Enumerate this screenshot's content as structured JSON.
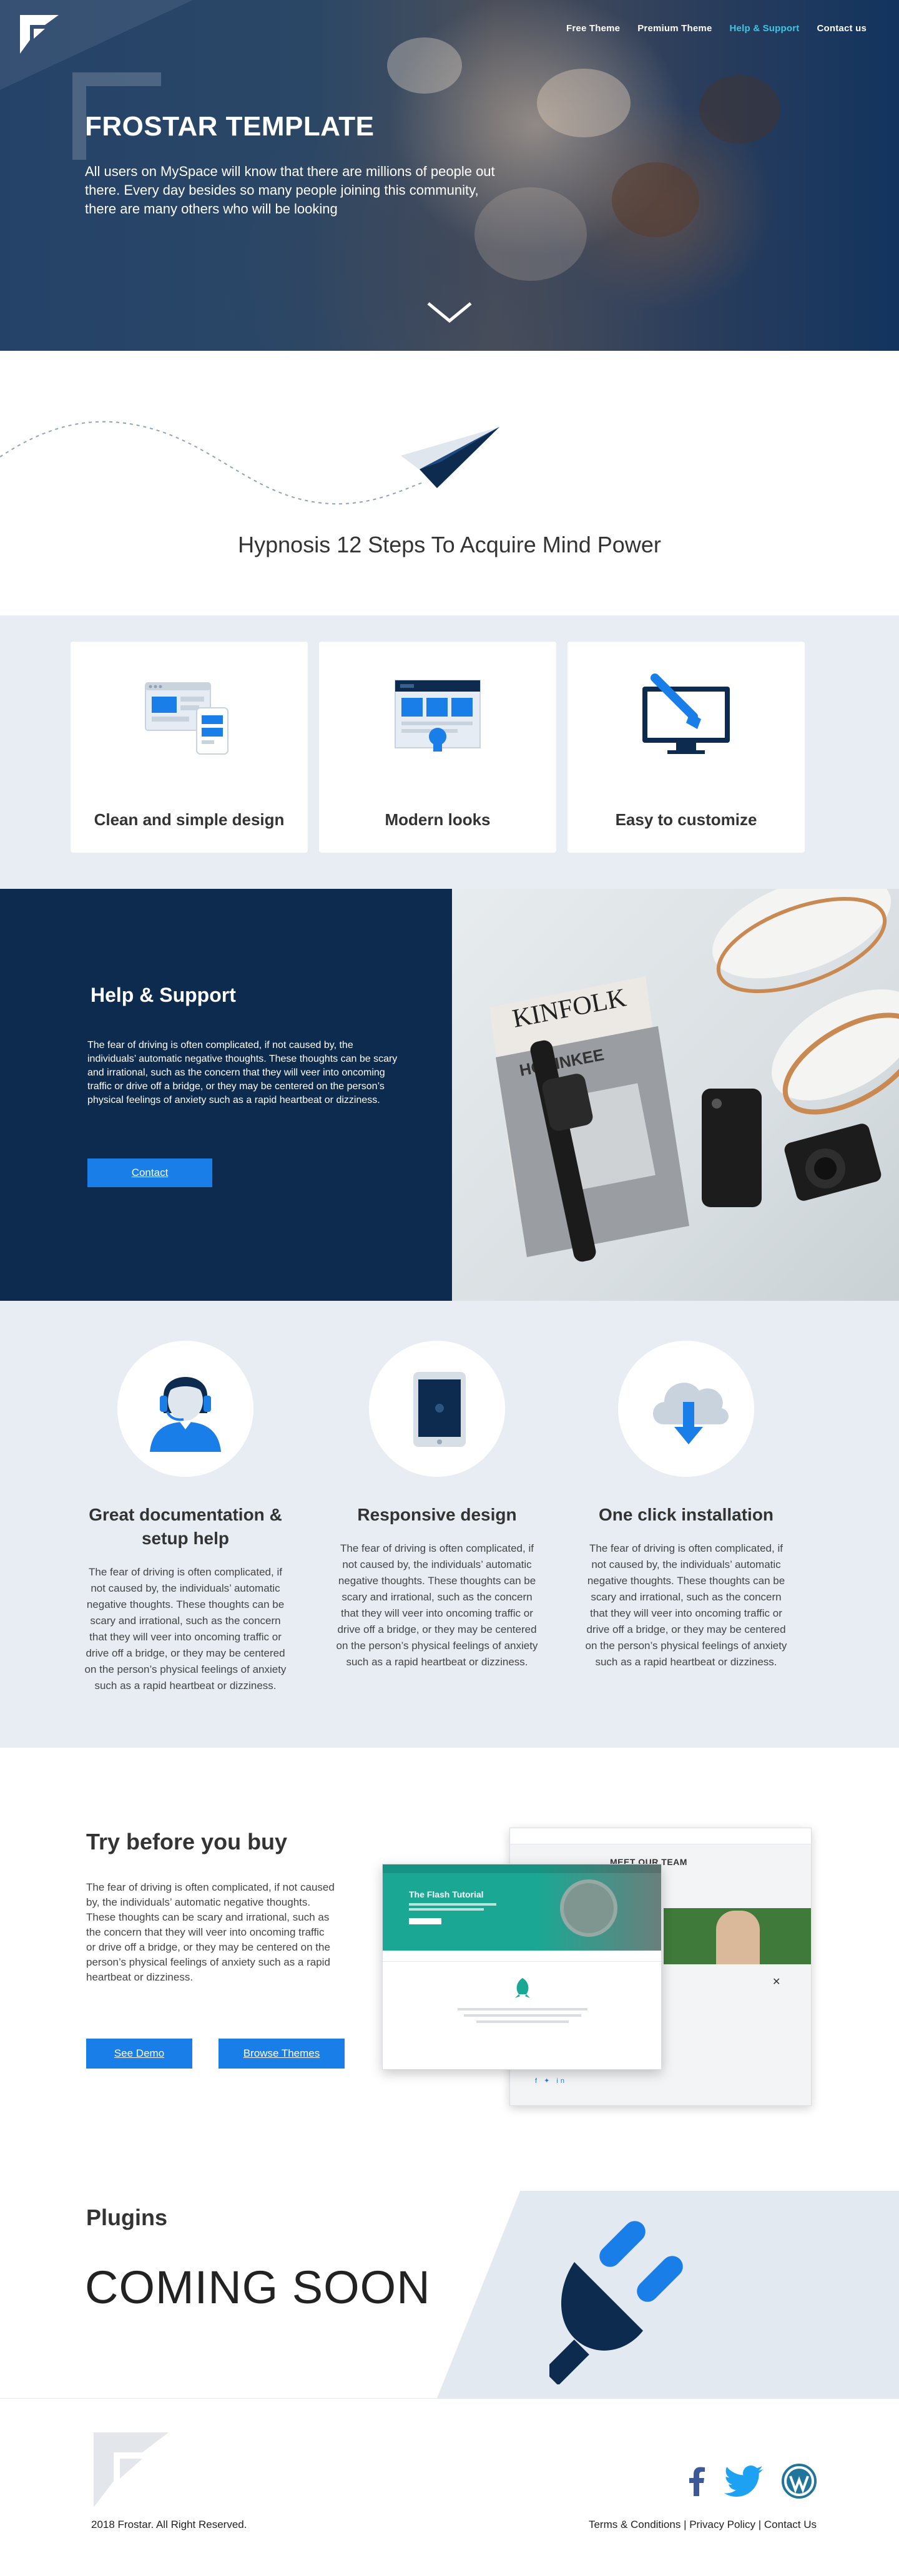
{
  "hero": {
    "nav": [
      {
        "label": "Free Theme",
        "active": false
      },
      {
        "label": "Premium Theme",
        "active": false
      },
      {
        "label": "Help & Support",
        "active": true
      },
      {
        "label": "Contact us",
        "active": false
      }
    ],
    "title": "FROSTAR TEMPLATE",
    "text": "All users on MySpace will know that there are millions of people out there. Every day besides so many people joining this community, there are many others who will be looking",
    "nav_active_color": "#3ec6e0"
  },
  "intro": {
    "heading": "Hypnosis 12 Steps To Acquire Mind Power"
  },
  "features": [
    {
      "label": "Clean and simple design",
      "icon": "devices-icon"
    },
    {
      "label": "Modern looks",
      "icon": "webpage-icon"
    },
    {
      "label": "Easy to customize",
      "icon": "monitor-brush-icon"
    }
  ],
  "help": {
    "title": "Help & Support",
    "text": "The fear of driving is often complicated, if not caused by, the individuals’ automatic negative thoughts. These thoughts can be scary and irrational, such as the concern that they will veer into oncoming traffic or drive off a bridge, or they may be centered on the person’s physical feelings of anxiety such as a rapid heartbeat or dizziness.",
    "button": "Contact",
    "photo_texts": {
      "magazine": "KINFOLK",
      "brand": "HODINKEE"
    }
  },
  "docs": [
    {
      "title": "Great documentation & setup help",
      "icon": "support-agent-icon",
      "text": "The fear of driving is often complicated, if not caused by, the individuals’ automatic negative thoughts. These thoughts can be scary and irrational, such as the concern that they will veer into oncoming traffic or drive off a bridge, or they may be centered on the person’s physical feelings of anxiety such as a rapid heartbeat or dizziness."
    },
    {
      "title": "Responsive design",
      "icon": "tablet-icon",
      "text": "The fear of driving is often complicated, if not caused by, the individuals’ automatic negative thoughts. These thoughts can be scary and irrational, such as the concern that they will veer into oncoming traffic or drive off a bridge, or they may be centered on the person’s physical feelings of anxiety such as a rapid heartbeat or dizziness."
    },
    {
      "title": "One click installation",
      "icon": "cloud-download-icon",
      "text": "The fear of driving is often complicated, if not caused by, the individuals’ automatic negative thoughts. These thoughts can be scary and irrational, such as the concern that they will veer into oncoming traffic or drive off a bridge, or they may be centered on the person’s physical feelings of anxiety such as a rapid heartbeat or dizziness."
    }
  ],
  "try": {
    "title": "Try before you buy",
    "text": "The fear of driving is often complicated, if not caused by, the individuals’ automatic negative thoughts. These thoughts can be scary and irrational, such as the concern that they will veer into oncoming traffic or drive off a bridge, or they may be centered on the person’s physical feelings of anxiety such as a rapid heartbeat or dizziness.",
    "demo_button": "See Demo",
    "themes_button": "Browse Themes",
    "preview_back_heading": "MEET OUR TEAM",
    "preview_front_heading": "The Flash Tutorial"
  },
  "plugins": {
    "title": "Plugins",
    "status": "COMING SOON"
  },
  "footer": {
    "copyright": "2018 Frostar. All Right Reserved.",
    "links": [
      "Terms & Conditions",
      "Privacy Policy",
      "Contact Us"
    ],
    "separator": " | ",
    "social": [
      "facebook-icon",
      "twitter-icon",
      "wordpress-icon"
    ]
  },
  "colors": {
    "primary_dark": "#0d2b4e",
    "accent_blue": "#1a7ee8",
    "light_bg": "#e8edf4",
    "nav_active": "#3ec6e0"
  }
}
